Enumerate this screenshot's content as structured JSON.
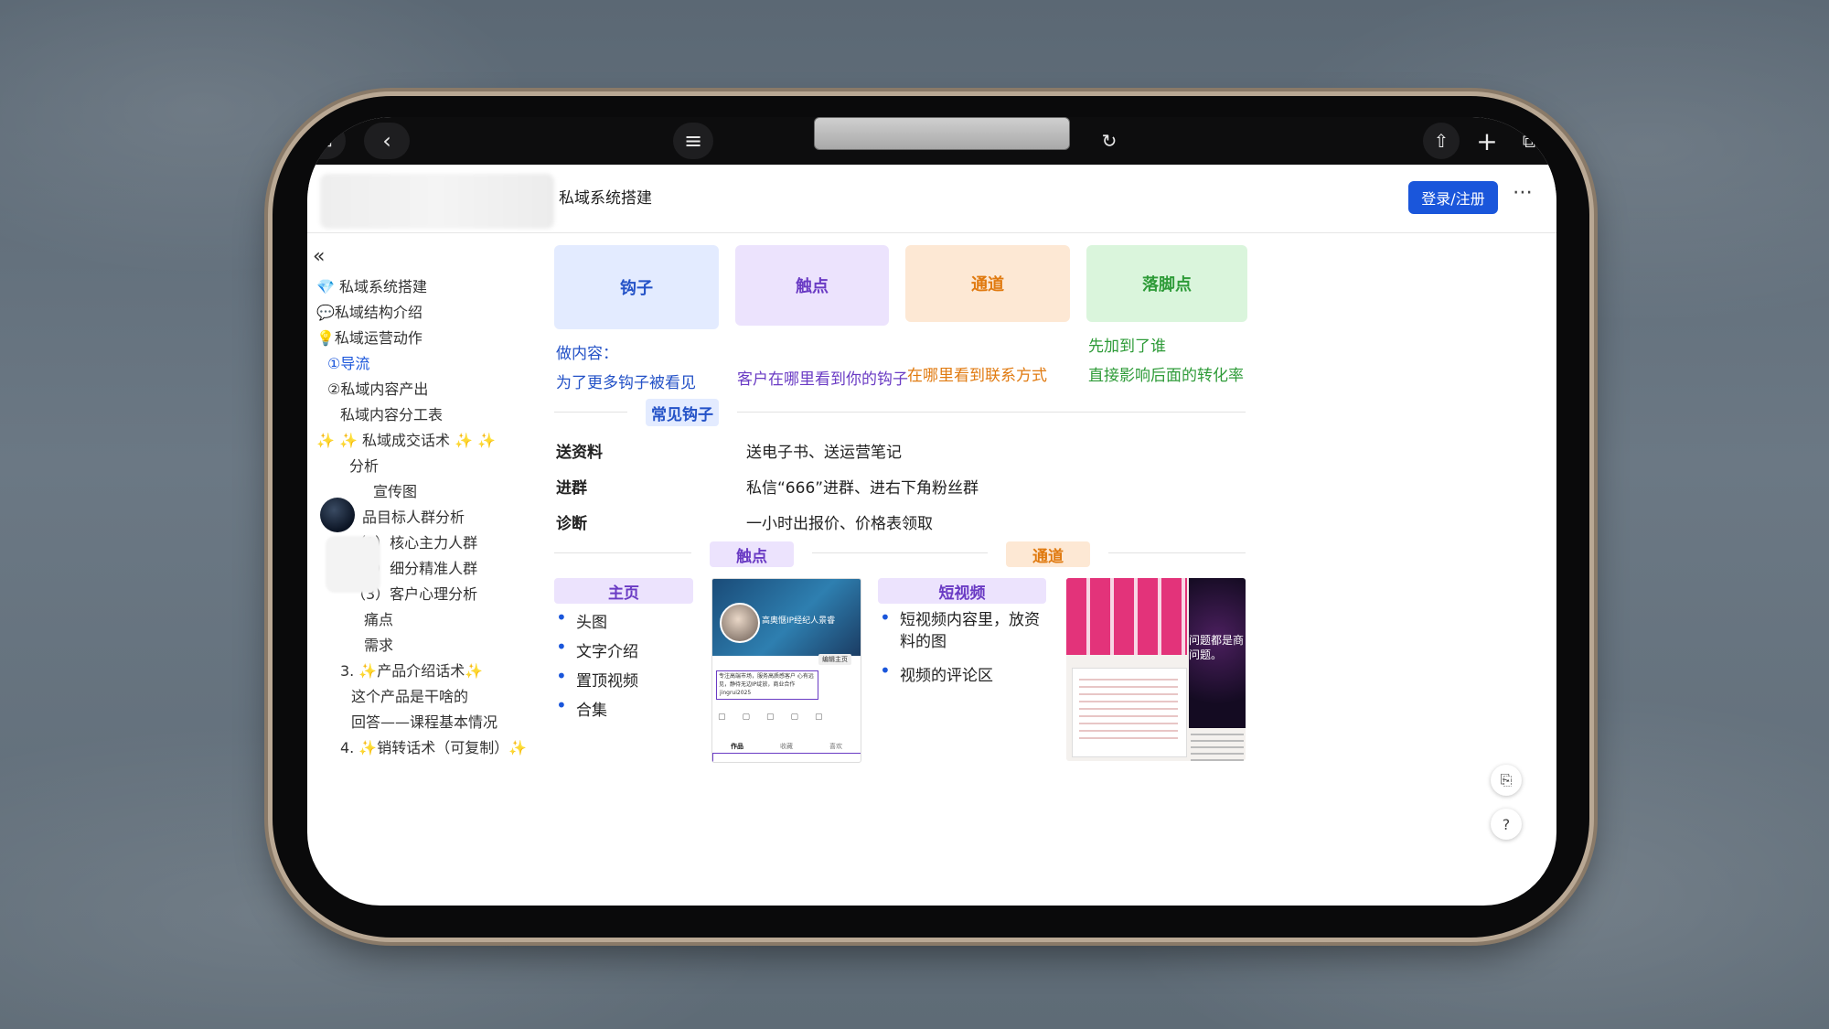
{
  "header": {
    "title": "私域系统搭建",
    "login_label": "登录/注册",
    "more_icon": "⋯"
  },
  "sidebar": {
    "collapse_icon": "«",
    "items": [
      {
        "label": "💎 私域系统搭建"
      },
      {
        "label": "💬私域结构介绍"
      },
      {
        "label": "💡私域运营动作"
      },
      {
        "label": "①导流",
        "active": true
      },
      {
        "label": "②私域内容产出"
      },
      {
        "label": "私域内容分工表"
      },
      {
        "label": "✨ ✨ 私域成交话术 ✨ ✨"
      },
      {
        "label": "分析"
      },
      {
        "label": "宣传图"
      },
      {
        "label": "品目标人群分析"
      },
      {
        "label": "（1）核心主力人群"
      },
      {
        "label": "（2）细分精准人群"
      },
      {
        "label": "（3）客户心理分析"
      },
      {
        "label": "痛点"
      },
      {
        "label": "需求"
      },
      {
        "label": "3. ✨产品介绍话术✨"
      },
      {
        "label": "这个产品是干啥的"
      },
      {
        "label": "回答——课程基本情况"
      },
      {
        "label": "4. ✨销转话术（可复制）✨"
      }
    ]
  },
  "cards": [
    {
      "label": "钩子",
      "line1": "做内容：",
      "line2": "为了更多钩子被看见"
    },
    {
      "label": "触点",
      "line1": "",
      "line2": "客户在哪里看到你的钩子"
    },
    {
      "label": "通道",
      "line1": "",
      "line2": "在哪里看到联系方式"
    },
    {
      "label": "落脚点",
      "line1": "先加到了谁",
      "line2": "直接影响后面的转化率"
    }
  ],
  "common_hooks": {
    "title": "常见钩子",
    "rows": [
      {
        "label": "送资料",
        "value": "送电子书、送运营笔记"
      },
      {
        "label": "进群",
        "value": "私信“666”进群、进右下角粉丝群"
      },
      {
        "label": "诊断",
        "value": "一小时出报价、价格表领取"
      }
    ]
  },
  "section_tags": {
    "touchpoint": "触点",
    "channel": "通道"
  },
  "homepage": {
    "title": "主页",
    "items": [
      "头图",
      "文字介绍",
      "置顶视频",
      "合集"
    ]
  },
  "short_video": {
    "title": "短视频",
    "items": [
      "短视频内容里，放资料的图",
      "视频的评论区"
    ]
  },
  "profile_shot": {
    "name": "高奥惬IP经纪人景睿",
    "bio": "专注高端市场，服务高质感客户 心有远见，静待无边IP绽放，商业合作",
    "handle": "jingrui2025",
    "tab_works": "作品",
    "tab_liked": "收藏",
    "tab_fav": "喜欢",
    "edit": "编辑主页"
  },
  "video_shot": {
    "caption": "问题都是商问题。"
  },
  "colors": {
    "hook_bg": "#e3ebff",
    "hook_fg": "#2452c7",
    "touch_bg": "#ece3fd",
    "touch_fg": "#6a3bc4",
    "channel_bg": "#fde8d4",
    "channel_fg": "#e07a10",
    "landing_bg": "#daf5dc",
    "landing_fg": "#2e9b38"
  }
}
